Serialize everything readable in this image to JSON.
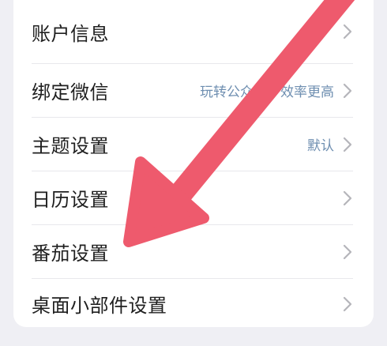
{
  "settings": {
    "items": [
      {
        "label": "账户信息",
        "value": ""
      },
      {
        "label": "绑定微信",
        "value": "玩转公众号，效率更高"
      },
      {
        "label": "主题设置",
        "value": "默认"
      },
      {
        "label": "日历设置",
        "value": ""
      },
      {
        "label": "番茄设置",
        "value": ""
      },
      {
        "label": "桌面小部件设置",
        "value": ""
      }
    ]
  },
  "colors": {
    "annotation_arrow": "#ee5a6d",
    "value_text": "#6f8fb1",
    "chevron": "#b5b5ba"
  }
}
